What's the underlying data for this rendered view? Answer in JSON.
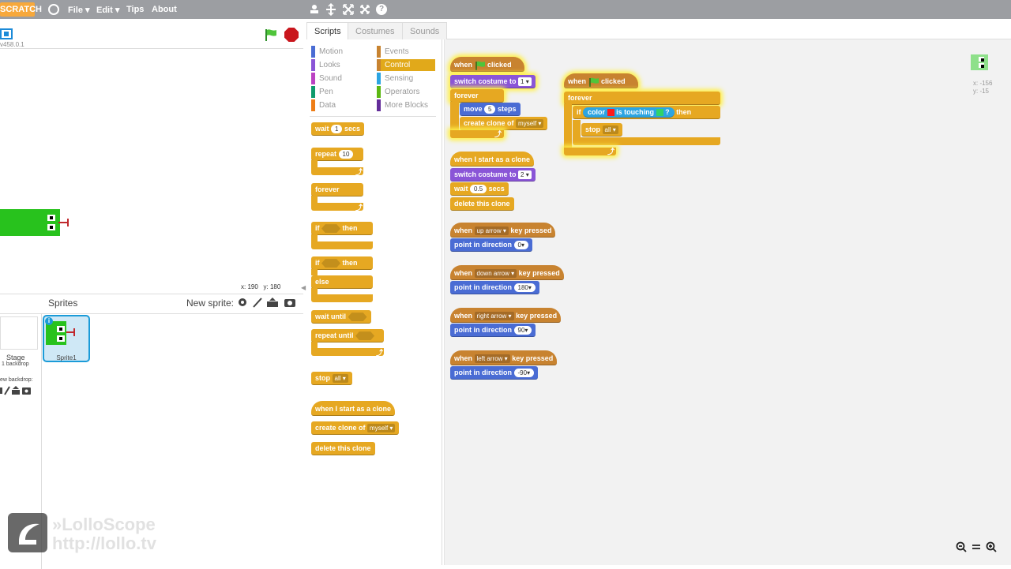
{
  "menubar": {
    "logo_text": "SCRATCH",
    "file": "File ▾",
    "edit": "Edit ▾",
    "tips": "Tips",
    "about": "About",
    "help_glyph": "?"
  },
  "stage": {
    "version": "v458.0.1",
    "mouse_x_label": "x:",
    "mouse_x": "190",
    "mouse_y_label": "y:",
    "mouse_y": "180"
  },
  "sprites_pane": {
    "title": "Sprites",
    "new_sprite_label": "New sprite:",
    "stage_label": "Stage",
    "backdrop_count": "1 backdrop",
    "new_backdrop_label": "ew backdrop:",
    "sprite_name": "Sprite1",
    "info_glyph": "i"
  },
  "watermark": {
    "line1": "»LolloScope",
    "line2": "http://lollo.tv"
  },
  "tabs": {
    "scripts": "Scripts",
    "costumes": "Costumes",
    "sounds": "Sounds"
  },
  "categories": {
    "motion": "Motion",
    "looks": "Looks",
    "sound": "Sound",
    "pen": "Pen",
    "data": "Data",
    "events": "Events",
    "control": "Control",
    "sensing": "Sensing",
    "operators": "Operators",
    "more_blocks": "More Blocks"
  },
  "palette": {
    "wait": "wait",
    "wait_val": "1",
    "secs": "secs",
    "repeat": "repeat",
    "repeat_val": "10",
    "forever": "forever",
    "if": "if",
    "then": "then",
    "else": "else",
    "wait_until": "wait until",
    "repeat_until": "repeat until",
    "stop": "stop",
    "stop_opt": "all",
    "when_clone": "when I start as a clone",
    "create_clone": "create clone of",
    "create_clone_opt": "myself",
    "delete_clone": "delete this clone"
  },
  "scripts": {
    "s1_when": "when",
    "s1_clicked": "clicked",
    "s1_switch": "switch costume to",
    "s1_switch_val": "1",
    "s1_forever": "forever",
    "s1_move": "move",
    "s1_move_val": "5",
    "s1_steps": "steps",
    "s1_create": "create clone of",
    "s1_create_val": "myself",
    "s2_when": "when I start as a clone",
    "s2_switch": "switch costume to",
    "s2_switch_val": "2",
    "s2_wait": "wait",
    "s2_wait_val": "0.5",
    "s2_secs": "secs",
    "s2_delete": "delete this clone",
    "s3_when": "when",
    "s3_clicked": "clicked",
    "s3_forever": "forever",
    "s3_if": "if",
    "s3_color": "color",
    "s3_touching": "is touching",
    "s3_q": "?",
    "s3_then": "then",
    "s3_stop": "stop",
    "s3_stop_val": "all",
    "k1_when": "when",
    "k1_key": "up arrow",
    "k1_pressed": "key pressed",
    "k1_point": "point in direction",
    "k1_val": "0",
    "k2_when": "when",
    "k2_key": "down arrow",
    "k2_pressed": "key pressed",
    "k2_point": "point in direction",
    "k2_val": "180",
    "k3_when": "when",
    "k3_key": "right arrow",
    "k3_pressed": "key pressed",
    "k3_point": "point in direction",
    "k3_val": "90",
    "k4_when": "when",
    "k4_key": "left arrow",
    "k4_pressed": "key pressed",
    "k4_point": "point in direction",
    "k4_val": "-90"
  },
  "sprite_info": {
    "x": "x: -156",
    "y": "y: -15"
  },
  "colors": {
    "control": "#e6a822",
    "events": "#c88330",
    "looks": "#8a55d7",
    "motion": "#4a6cd4",
    "sensing": "#2ca5e2",
    "sprite_green": "#28c21d",
    "touch_red": "#ff1a1a",
    "touch_green": "#2fd36b"
  }
}
